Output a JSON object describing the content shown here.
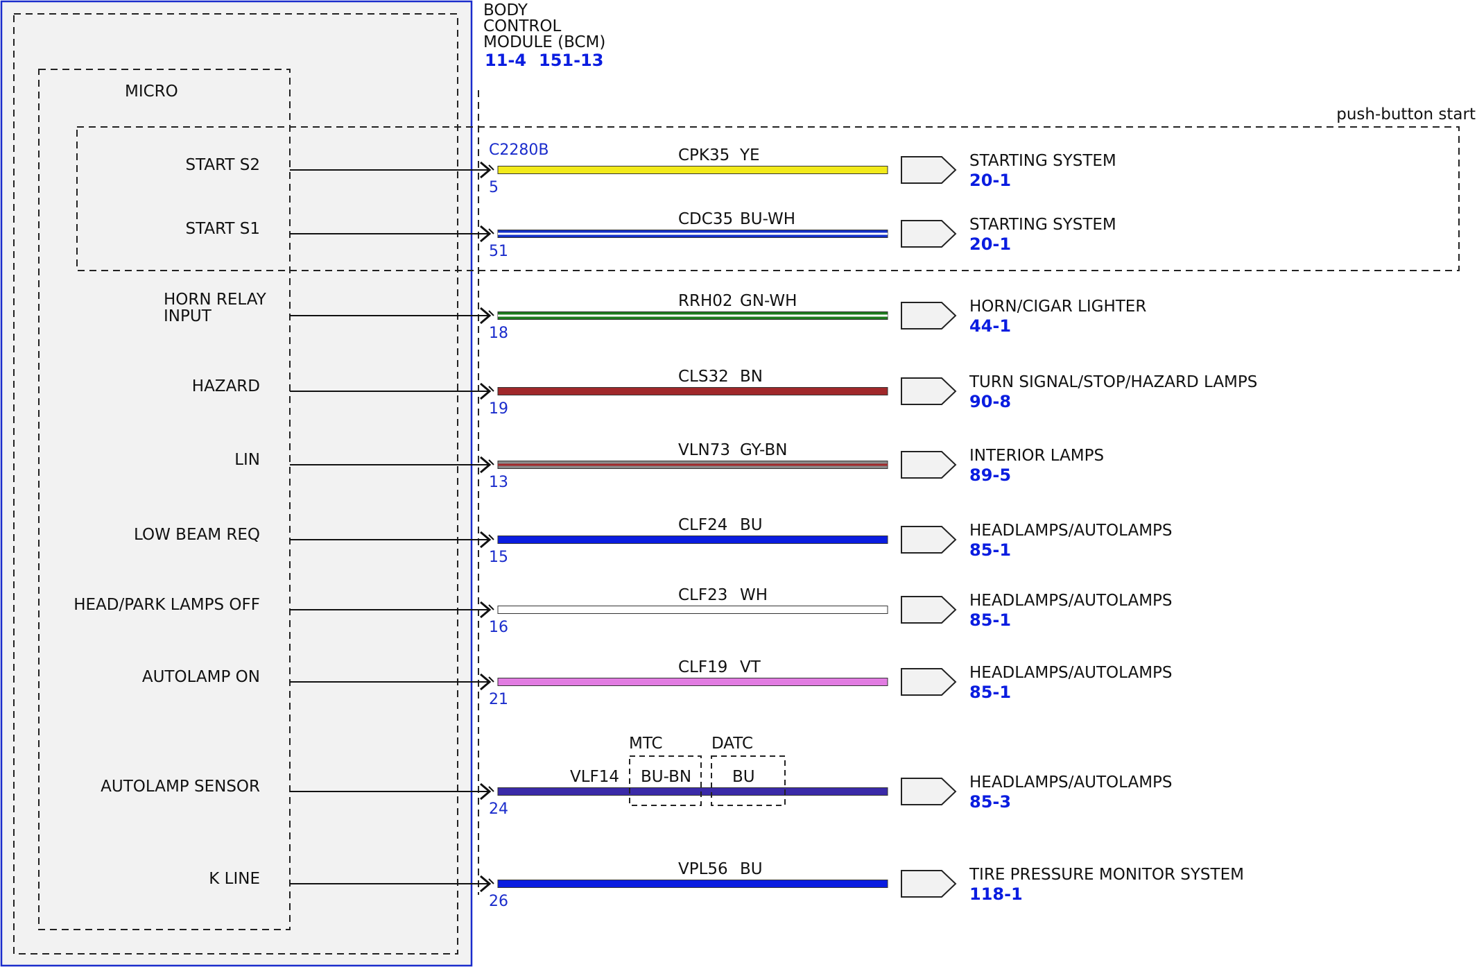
{
  "module": {
    "title_lines": [
      "BODY",
      "CONTROL",
      "MODULE (BCM)"
    ],
    "refs": [
      "11-4",
      "151-13"
    ],
    "inner_label": "MICRO",
    "connector": "C2280B"
  },
  "option_box_label": "push-button start",
  "circuits": [
    {
      "signal": [
        "START S2"
      ],
      "pin": "5",
      "circuit": "CPK35",
      "color_code": "YE",
      "wire_colors": [
        "#f2ea1a"
      ],
      "dest": "STARTING SYSTEM",
      "dest_ref": "20-1"
    },
    {
      "signal": [
        "START S1"
      ],
      "pin": "51",
      "circuit": "CDC35",
      "color_code": "BU-WH",
      "wire_colors": [
        "#1430c8",
        "#ffffff"
      ],
      "dest": "STARTING SYSTEM",
      "dest_ref": "20-1"
    },
    {
      "signal": [
        "HORN RELAY",
        "INPUT"
      ],
      "pin": "18",
      "circuit": "RRH02",
      "color_code": "GN-WH",
      "wire_colors": [
        "#1e7a1e",
        "#ffffff"
      ],
      "dest": "HORN/CIGAR LIGHTER",
      "dest_ref": "44-1"
    },
    {
      "signal": [
        "HAZARD"
      ],
      "pin": "19",
      "circuit": "CLS32",
      "color_code": "BN",
      "wire_colors": [
        "#a0282a"
      ],
      "dest": "TURN SIGNAL/STOP/HAZARD LAMPS",
      "dest_ref": "90-8"
    },
    {
      "signal": [
        "LIN"
      ],
      "pin": "13",
      "circuit": "VLN73",
      "color_code": "GY-BN",
      "wire_colors": [
        "#8a8a8a",
        "#a0282a"
      ],
      "dest": "INTERIOR LAMPS",
      "dest_ref": "89-5"
    },
    {
      "signal": [
        "LOW BEAM REQ"
      ],
      "pin": "15",
      "circuit": "CLF24",
      "color_code": "BU",
      "wire_colors": [
        "#0a1de0"
      ],
      "dest": "HEADLAMPS/AUTOLAMPS",
      "dest_ref": "85-1"
    },
    {
      "signal": [
        "HEAD/PARK LAMPS OFF"
      ],
      "pin": "16",
      "circuit": "CLF23",
      "color_code": "WH",
      "wire_colors": [
        "#ffffff"
      ],
      "dest": "HEADLAMPS/AUTOLAMPS",
      "dest_ref": "85-1"
    },
    {
      "signal": [
        "AUTOLAMP ON"
      ],
      "pin": "21",
      "circuit": "CLF19",
      "color_code": "VT",
      "wire_colors": [
        "#e27ce2"
      ],
      "dest": "HEADLAMPS/AUTOLAMPS",
      "dest_ref": "85-1"
    },
    {
      "signal": [
        "AUTOLAMP SENSOR"
      ],
      "pin": "24",
      "circuit": "VLF14",
      "color_code": "",
      "wire_colors": [
        "#3a2aa8"
      ],
      "dest": "HEADLAMPS/AUTOLAMPS",
      "dest_ref": "85-3",
      "variants": [
        {
          "option": "MTC",
          "color_code": "BU-BN"
        },
        {
          "option": "DATC",
          "color_code": "BU"
        }
      ]
    },
    {
      "signal": [
        "K LINE"
      ],
      "pin": "26",
      "circuit": "VPL56",
      "color_code": "BU",
      "wire_colors": [
        "#0a1de0"
      ],
      "dest": "TIRE PRESSURE MONITOR SYSTEM",
      "dest_ref": "118-1"
    }
  ],
  "colors": {
    "module_border": "#1a2ccc",
    "module_fill": "#f2f2f2",
    "ref_text": "#0a1de0"
  }
}
